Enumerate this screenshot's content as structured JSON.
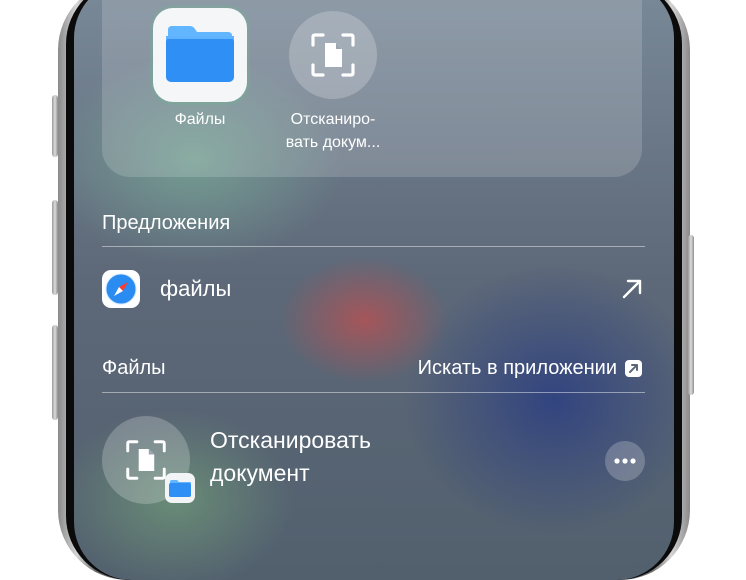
{
  "apps": [
    {
      "label": "Файлы",
      "icon": "files-folder-icon"
    },
    {
      "label_line1": "Отсканиро-",
      "label_line2": "вать докум...",
      "icon": "scan-document-icon"
    }
  ],
  "suggestions": {
    "header": "Предложения",
    "items": [
      {
        "text": "файлы",
        "icon": "safari-icon",
        "action_icon": "arrow-up-right-icon"
      }
    ]
  },
  "files_section": {
    "header": "Файлы",
    "search_in_app_label": "Искать в приложении",
    "results": [
      {
        "title_line1": "Отсканировать",
        "title_line2": "документ",
        "icon": "scan-document-icon",
        "badge_icon": "files-folder-icon",
        "more_icon": "more-ellipsis-icon"
      }
    ]
  },
  "colors": {
    "folder_blue": "#2f8ff5",
    "text": "#ffffff"
  }
}
